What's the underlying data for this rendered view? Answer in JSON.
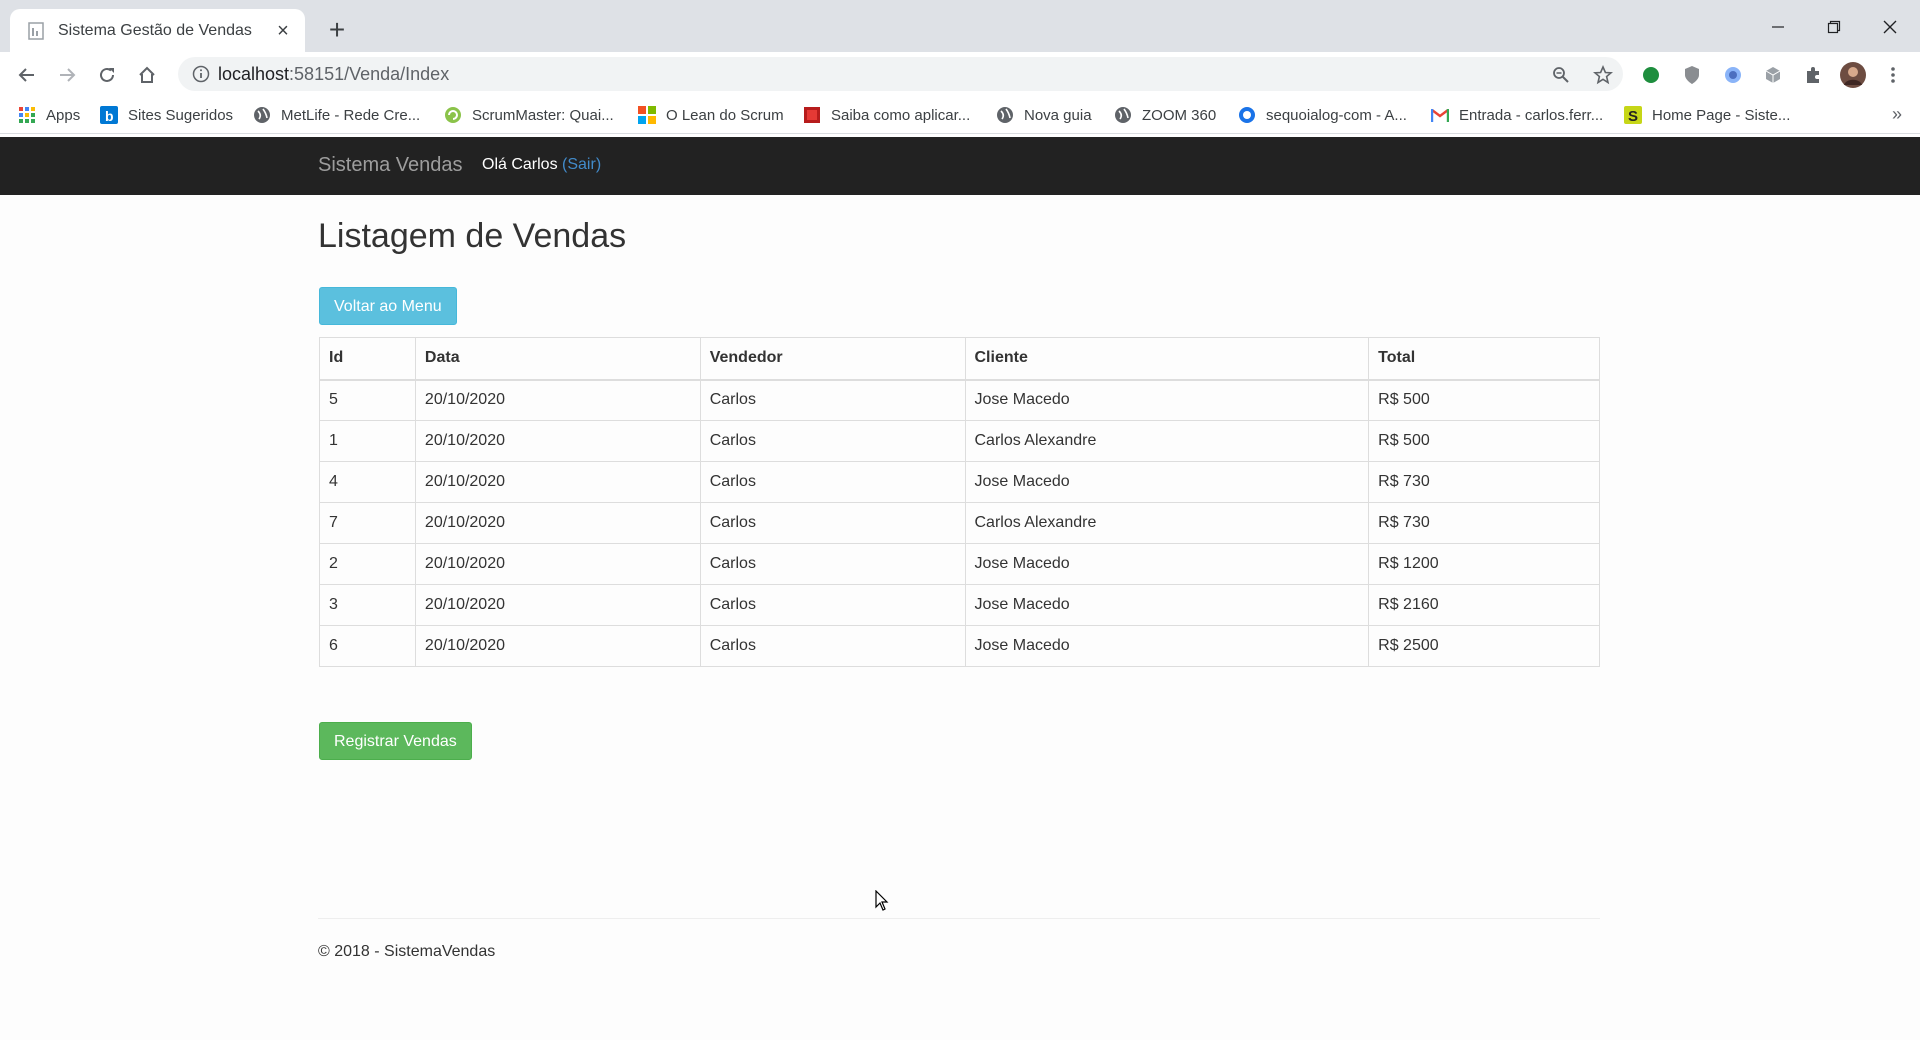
{
  "browser": {
    "tab_title": "Sistema Gestão de Vendas",
    "url_host": "localhost",
    "url_path": ":58151/Venda/Index",
    "bookmarks": [
      {
        "label": "Apps",
        "icon": "apps-grid-icon"
      },
      {
        "label": "Sites Sugeridos",
        "icon": "bing-icon"
      },
      {
        "label": "MetLife - Rede Cre...",
        "icon": "globe-icon"
      },
      {
        "label": "ScrumMaster: Quai...",
        "icon": "scrum-icon"
      },
      {
        "label": "O Lean do Scrum",
        "icon": "microsoft-icon"
      },
      {
        "label": "Saiba como aplicar...",
        "icon": "book-icon"
      },
      {
        "label": "Nova guia",
        "icon": "globe-icon"
      },
      {
        "label": "ZOOM 360",
        "icon": "globe-icon"
      },
      {
        "label": "sequoialog-com - A...",
        "icon": "circle-icon"
      },
      {
        "label": "Entrada - carlos.ferr...",
        "icon": "gmail-icon"
      },
      {
        "label": "Home Page - Siste...",
        "icon": "s-icon"
      }
    ],
    "bookmarks_more": "»"
  },
  "navbar": {
    "brand": "Sistema Vendas",
    "greeting": "Olá Carlos",
    "logout": "(Sair)"
  },
  "page": {
    "title": "Listagem de Vendas",
    "back_button": "Voltar ao Menu",
    "register_button": "Registrar Vendas",
    "footer": "© 2018 - SistemaVendas"
  },
  "table": {
    "headers": [
      "Id",
      "Data",
      "Vendedor",
      "Cliente",
      "Total"
    ],
    "rows": [
      [
        "5",
        "20/10/2020",
        "Carlos",
        "Jose Macedo",
        "R$ 500"
      ],
      [
        "1",
        "20/10/2020",
        "Carlos",
        "Carlos Alexandre",
        "R$ 500"
      ],
      [
        "4",
        "20/10/2020",
        "Carlos",
        "Jose Macedo",
        "R$ 730"
      ],
      [
        "7",
        "20/10/2020",
        "Carlos",
        "Carlos Alexandre",
        "R$ 730"
      ],
      [
        "2",
        "20/10/2020",
        "Carlos",
        "Jose Macedo",
        "R$ 1200"
      ],
      [
        "3",
        "20/10/2020",
        "Carlos",
        "Jose Macedo",
        "R$ 2160"
      ],
      [
        "6",
        "20/10/2020",
        "Carlos",
        "Jose Macedo",
        "R$ 2500"
      ]
    ]
  },
  "colors": {
    "navbar_bg": "#222222",
    "info_button": "#5bc0de",
    "success_button": "#5cb85c",
    "link": "#428bca"
  }
}
